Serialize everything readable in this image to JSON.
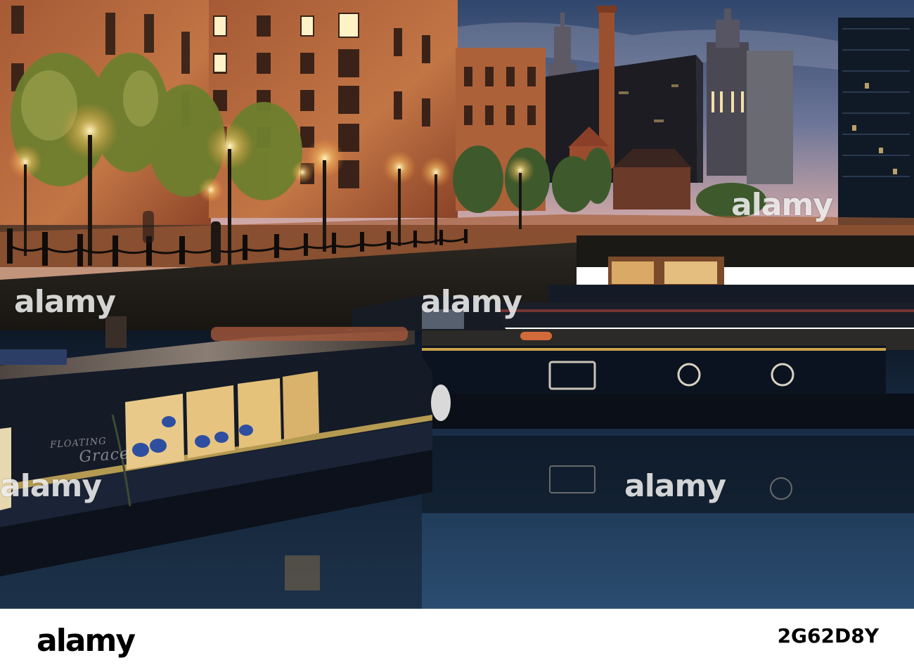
{
  "photo": {
    "boat_name": "FLOATING",
    "boat_name_script": "Grace",
    "watermark": [
      "alamy",
      "alamy",
      "alamy"
    ]
  },
  "footer": {
    "logo": "alamy",
    "image_id": "2G62D8Y"
  },
  "colors": {
    "sky_top": "#35486a",
    "sky_dusk": "#c9a5a8",
    "brick_lit": "#b8663c",
    "water": "#1a2d44",
    "lamp": "#ffe8a0"
  }
}
